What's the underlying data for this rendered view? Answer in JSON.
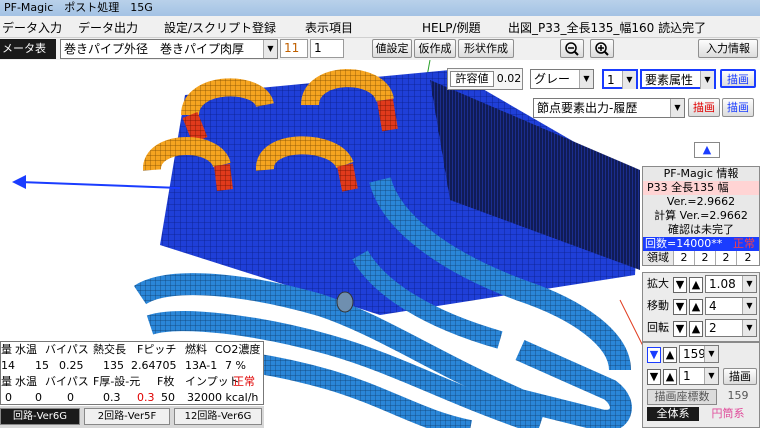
{
  "window": {
    "title": "PF-Magic　ポスト処理　15G"
  },
  "menu": {
    "items": [
      "データ入力",
      "データ出力",
      "設定/スクリプト登録",
      "表示項目",
      "HELP/例題",
      "出図_P33_全長135_幅160 読込完了"
    ]
  },
  "toolbar": {
    "mode_label": "メータ表示",
    "combo_value": "巻きパイプ外径　巻きパイプ肉厚",
    "field_a": "11",
    "field_b": "1",
    "btn_value_set": "値設定",
    "btn_temp_make": "仮作成",
    "btn_shape_make": "形状作成",
    "btn_input_info": "入力情報"
  },
  "view_controls": {
    "tolerance_label": "許容値",
    "tolerance_value": "0.02",
    "color_combo": "グレー",
    "elem_num": "1",
    "elem_attr": "要素属性",
    "draw_label": "描画",
    "node_output": "節点要素出力-履歴",
    "draw_label2": "描画",
    "draw_label3": "描画"
  },
  "info_panel": {
    "title": "PF-Magic 情報",
    "line1": "P33 全長135 幅",
    "line2": "Ver.=2.9662",
    "line3": "計算 Ver.=2.9662",
    "line4": "確認は未完了",
    "line5a": "回数=14000**",
    "line5b": "正常",
    "region_label": "領域",
    "region_vals": [
      "2",
      "2",
      "2",
      "2"
    ]
  },
  "zoom_panel": {
    "zoom_label": "拡大",
    "zoom_value": "1.08",
    "move_label": "移動",
    "move_value": "4",
    "rotate_label": "回転",
    "rotate_value": "2"
  },
  "draw_panel": {
    "val1": "159",
    "val2": "1",
    "draw_btn": "描画",
    "coord_label": "描画座標数",
    "coord_value": "159",
    "global_sys": "全体系",
    "cyl_sys": "円筒系"
  },
  "bottom_table": {
    "row1": [
      "量",
      "水温",
      "バイパス",
      "熱交長",
      "Fピッチ",
      "燃料",
      "CO2濃度"
    ],
    "row2": [
      "14",
      "15",
      "0.25",
      "135",
      "2.64705",
      "13A-1",
      "7 %"
    ],
    "row3": [
      "量",
      "水温",
      "バイパス",
      "F厚-設-元",
      "F枚",
      "インプット",
      "正常"
    ],
    "row4": [
      "0",
      "0",
      "0",
      "0.3",
      "0.3",
      "50",
      "32000 kcal/h"
    ]
  },
  "tabs": [
    "回路-Ver6G",
    "2回路-Ver5F",
    "12回路-Ver6G"
  ],
  "colors": {
    "body": "#1f3fd8",
    "tube": "#2a86d8",
    "orange": "#f5a420",
    "red": "#e03a1c",
    "accent_blue": "#1a3cff"
  }
}
